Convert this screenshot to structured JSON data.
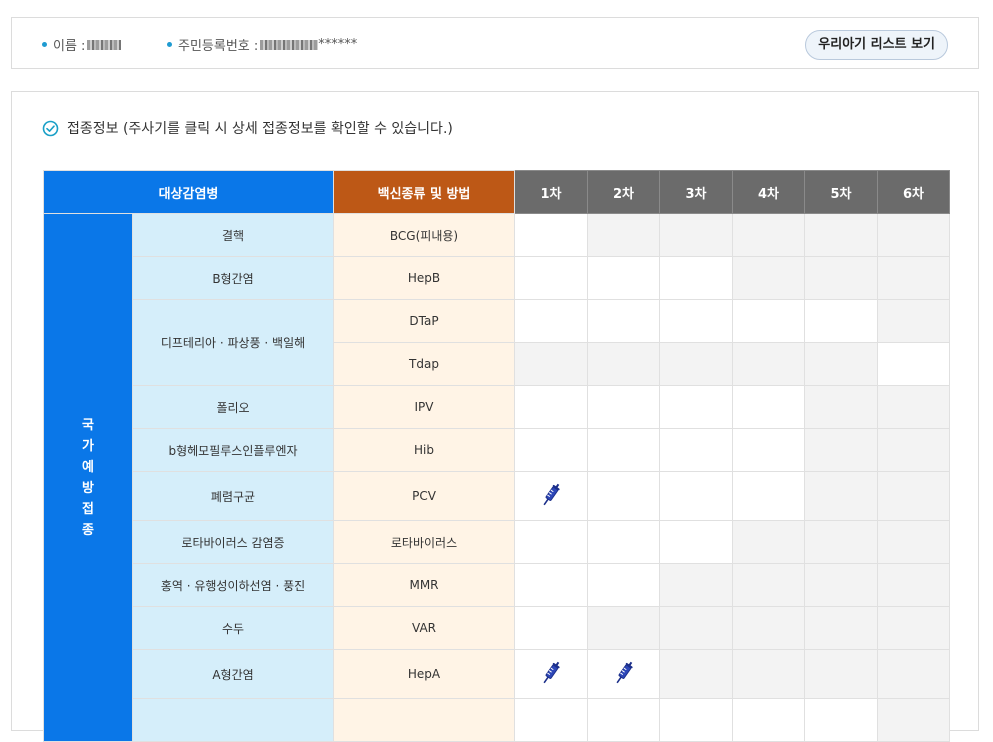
{
  "child": {
    "name_label": "이름 :",
    "id_label": "주민등록번호 :",
    "id_mask": "******",
    "list_button": "우리아기 리스트 보기"
  },
  "section": {
    "title": "접종정보 (주사기를 클릭 시 상세 접종정보를 확인할 수 있습니다.)"
  },
  "table": {
    "headers": {
      "disease": "대상감염병",
      "vaccine": "백신종류 및 방법",
      "doses": [
        "1차",
        "2차",
        "3차",
        "4차",
        "5차",
        "6차"
      ]
    },
    "category": [
      "국",
      "가",
      "예",
      "방",
      "접",
      "종"
    ],
    "rows": [
      {
        "disease": "결핵",
        "vaccine": "BCG(피내용)",
        "cells": [
          "w",
          "g",
          "g",
          "g",
          "g",
          "g"
        ]
      },
      {
        "disease": "B형간염",
        "vaccine": "HepB",
        "cells": [
          "w",
          "w",
          "w",
          "g",
          "g",
          "g"
        ]
      },
      {
        "disease": "디프테리아 · 파상풍 · 백일해",
        "vaccine": "DTaP",
        "cells": [
          "w",
          "w",
          "w",
          "w",
          "w",
          "g"
        ]
      },
      {
        "disease": "",
        "vaccine": "Tdap",
        "cells": [
          "g",
          "g",
          "g",
          "g",
          "g",
          "w"
        ]
      },
      {
        "disease": "폴리오",
        "vaccine": "IPV",
        "cells": [
          "w",
          "w",
          "w",
          "w",
          "g",
          "g"
        ]
      },
      {
        "disease": "b형헤모필루스인플루엔자",
        "vaccine": "Hib",
        "cells": [
          "w",
          "w",
          "w",
          "w",
          "g",
          "g"
        ]
      },
      {
        "disease": "폐렴구균",
        "vaccine": "PCV",
        "cells": [
          "s",
          "w",
          "w",
          "w",
          "g",
          "g"
        ]
      },
      {
        "disease": "로타바이러스 감염증",
        "vaccine": "로타바이러스",
        "cells": [
          "w",
          "w",
          "w",
          "g",
          "g",
          "g"
        ]
      },
      {
        "disease": "홍역 · 유행성이하선염 · 풍진",
        "vaccine": "MMR",
        "cells": [
          "w",
          "w",
          "g",
          "g",
          "g",
          "g"
        ]
      },
      {
        "disease": "수두",
        "vaccine": "VAR",
        "cells": [
          "w",
          "g",
          "g",
          "g",
          "g",
          "g"
        ]
      },
      {
        "disease": "A형간염",
        "vaccine": "HepA",
        "cells": [
          "s",
          "s",
          "g",
          "g",
          "g",
          "g"
        ]
      },
      {
        "disease": "",
        "vaccine": "",
        "cells": [
          "w",
          "w",
          "w",
          "w",
          "w",
          "g"
        ]
      }
    ]
  },
  "colors": {
    "disease_header": "#0a77e8",
    "vaccine_header": "#bd5816",
    "dose_header": "#6b6b6b",
    "disease_cell": "#d5eefa",
    "vaccine_cell": "#fff4e6",
    "syringe": "#2d47b8"
  }
}
